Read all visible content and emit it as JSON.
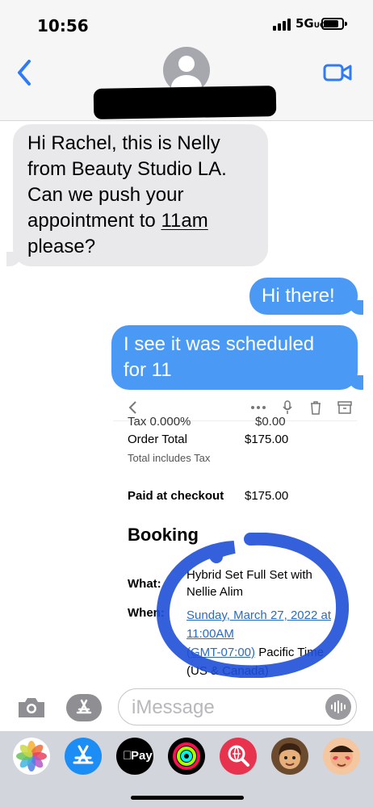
{
  "status_bar": {
    "time": "10:56",
    "network": "5G",
    "network_sub": "UC"
  },
  "messages": {
    "incoming_1": {
      "line1": "Hi Rachel, this is Nelly",
      "line2": "from Beauty Studio LA.",
      "line3": "Can we push your",
      "line4_prefix": "appointment to ",
      "line4_link": "11am",
      "line5": "please?"
    },
    "outgoing_1": "Hi there!",
    "outgoing_2": {
      "line1": "I see it was scheduled",
      "line2": "for 11"
    }
  },
  "embedded_screenshot": {
    "tax_label": "Tax 0.000%",
    "tax_value": "$0.00",
    "order_total_label": "Order Total",
    "order_total_value": "$175.00",
    "tax_note": "Total includes Tax",
    "paid_label": "Paid at checkout",
    "paid_value": "$175.00",
    "booking_heading": "Booking",
    "what_label": "What:",
    "what_line1": "Hybrid Set Full Set with",
    "what_line2": "Nellie Alim",
    "when_label": "When:",
    "when_line1": "Sunday, March 27, 2022 at",
    "when_line2": "11:00AM",
    "when_line3_link": "(GMT-07:00)",
    "when_line3_rest": " Pacific Time",
    "when_line4": "(US & Canada)",
    "annotation_color": "#1f4fd8"
  },
  "input": {
    "placeholder": "iMessage"
  },
  "app_drawer": {
    "apps": [
      "photos-icon",
      "app-store-icon",
      "apple-pay-icon",
      "fitness-icon",
      "search-web-icon",
      "memoji-icon",
      "memoji-2-icon"
    ],
    "apple_pay_label": "Pay"
  },
  "colors": {
    "outgoing_bubble": "#4a9af5",
    "incoming_bubble": "#e9e9eb",
    "accent": "#2f7bf6"
  }
}
